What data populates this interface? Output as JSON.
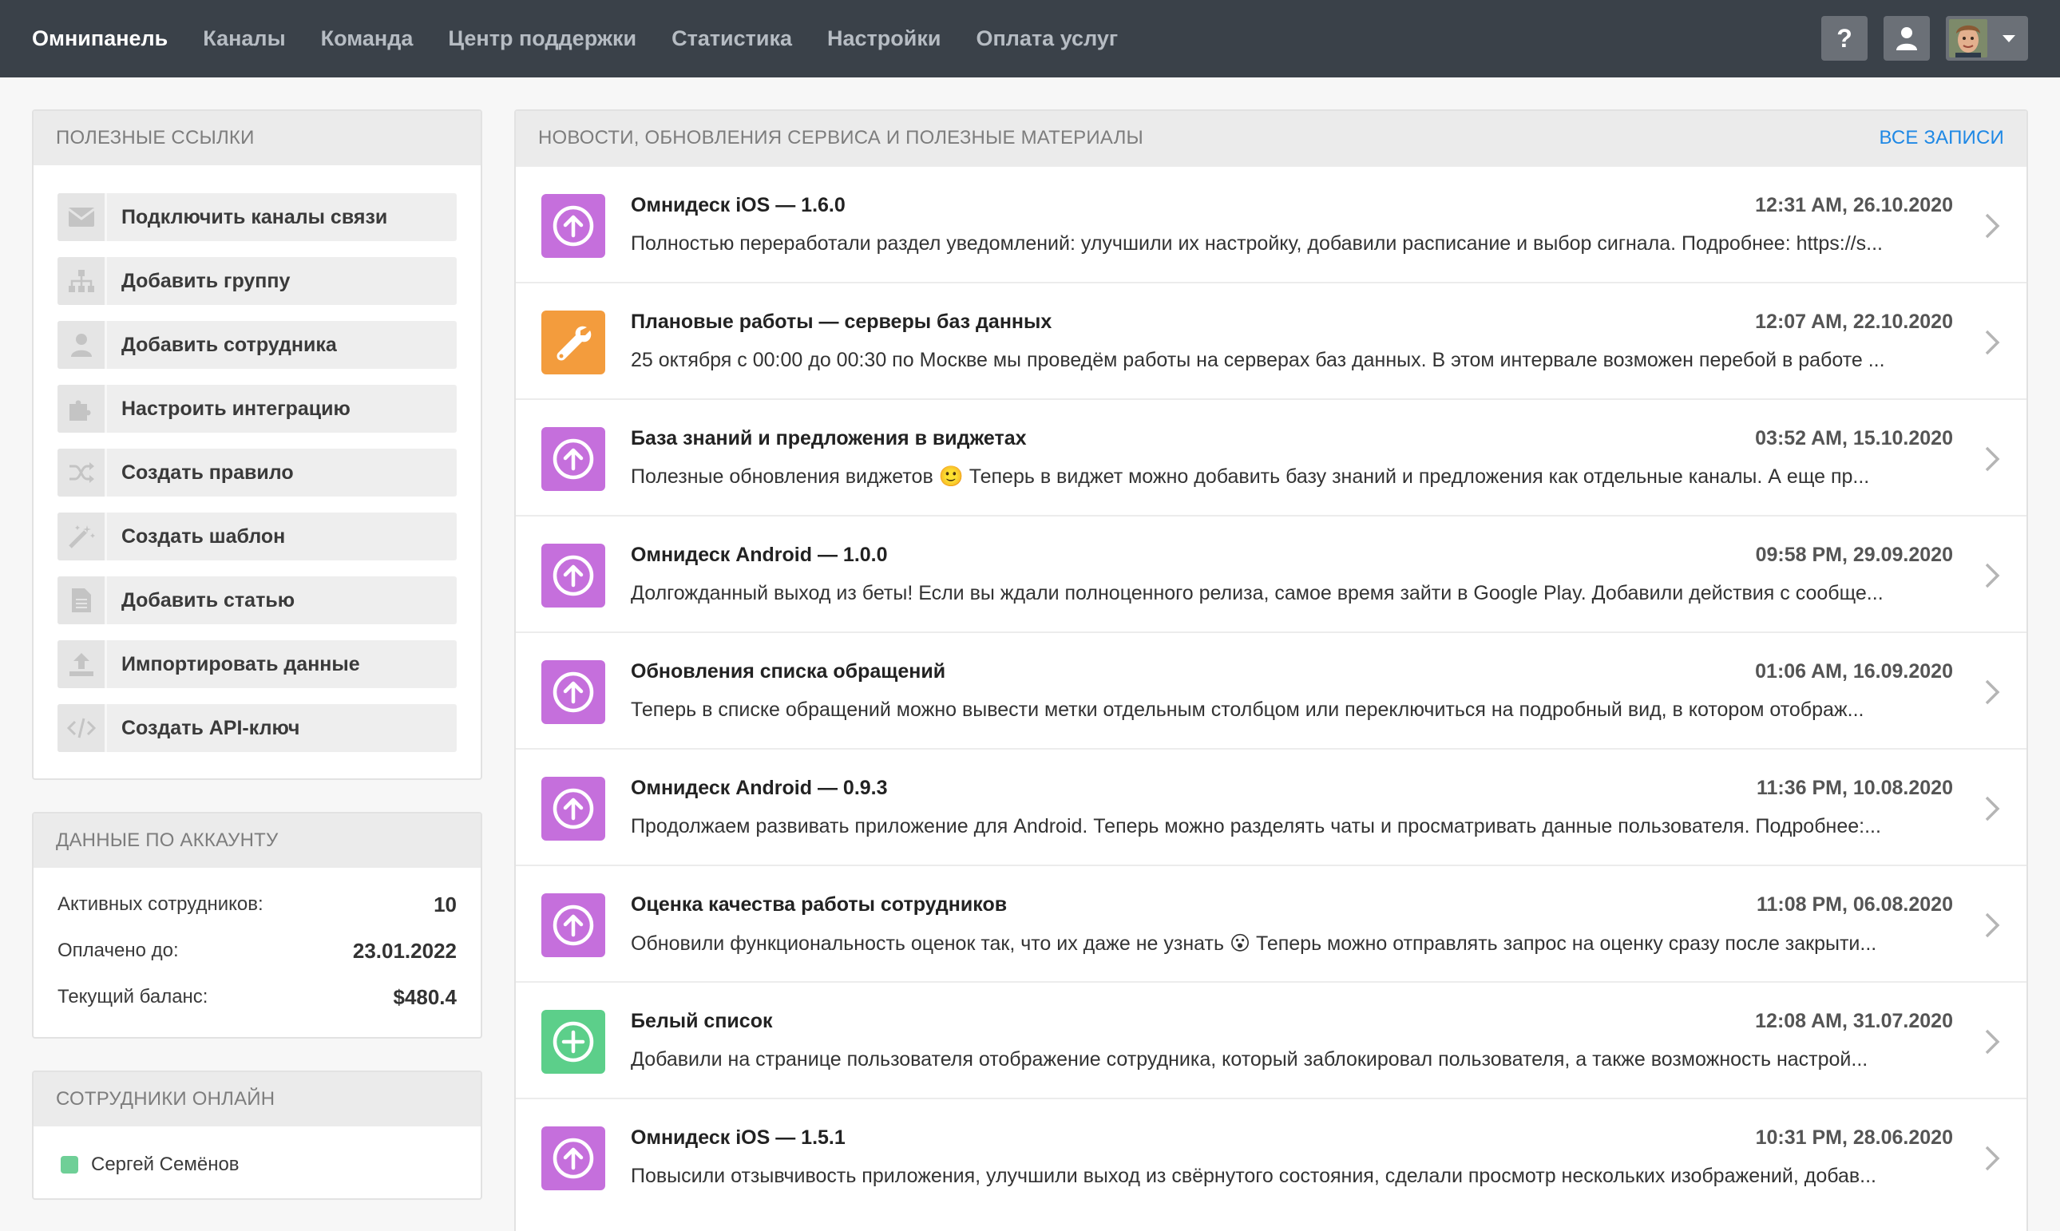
{
  "colors": {
    "topbar": "#3a4149",
    "update_icon": "#c56fdc",
    "maintenance_icon": "#f39c3d",
    "feature_icon": "#5ccf8a",
    "link": "#1e88e5",
    "online": "#6fcf97"
  },
  "nav": {
    "items": [
      {
        "label": "Омнипанель",
        "active": true
      },
      {
        "label": "Каналы",
        "active": false
      },
      {
        "label": "Команда",
        "active": false
      },
      {
        "label": "Центр поддержки",
        "active": false
      },
      {
        "label": "Статистика",
        "active": false
      },
      {
        "label": "Настройки",
        "active": false
      },
      {
        "label": "Оплата услуг",
        "active": false
      }
    ],
    "help_label": "?",
    "icons": [
      "question-icon",
      "user-icon",
      "avatar",
      "caret-down-icon"
    ]
  },
  "links": {
    "title": "ПОЛЕЗНЫЕ ССЫЛКИ",
    "items": [
      {
        "label": "Подключить каналы связи",
        "icon": "envelope-icon"
      },
      {
        "label": "Добавить группу",
        "icon": "sitemap-icon"
      },
      {
        "label": "Добавить сотрудника",
        "icon": "user-icon"
      },
      {
        "label": "Настроить интеграцию",
        "icon": "puzzle-icon"
      },
      {
        "label": "Создать правило",
        "icon": "shuffle-icon"
      },
      {
        "label": "Создать шаблон",
        "icon": "magic-wand-icon"
      },
      {
        "label": "Добавить статью",
        "icon": "document-icon"
      },
      {
        "label": "Импортировать данные",
        "icon": "upload-icon"
      },
      {
        "label": "Создать API-ключ",
        "icon": "code-icon"
      }
    ]
  },
  "account": {
    "title": "ДАННЫЕ ПО АККАУНТУ",
    "rows": [
      {
        "label": "Активных сотрудников:",
        "value": "10"
      },
      {
        "label": "Оплачено до:",
        "value": "23.01.2022"
      },
      {
        "label": "Текущий баланс:",
        "value": "$480.4"
      }
    ]
  },
  "online": {
    "title": "СОТРУДНИКИ ОНЛАЙН",
    "users": [
      {
        "name": "Сергей Семёнов"
      }
    ]
  },
  "news": {
    "title": "НОВОСТИ, ОБНОВЛЕНИЯ СЕРВИСА И ПОЛЕЗНЫЕ МАТЕРИАЛЫ",
    "all_label": "ВСЕ ЗАПИСИ",
    "items": [
      {
        "icon": "arrow-up-circle-icon",
        "kind": "update",
        "title": "Омнидеск iOS — 1.6.0",
        "date": "12:31 AM, 26.10.2020",
        "text": "Полностью переработали раздел уведомлений: улучшили их настройку, добавили расписание и выбор сигнала. Подробнее: https://s..."
      },
      {
        "icon": "wrench-icon",
        "kind": "maintenance",
        "title": "Плановые работы — серверы баз данных",
        "date": "12:07 AM, 22.10.2020",
        "text": "25 октября с 00:00 до 00:30 по Москве мы проведём работы на серверах баз данных. В этом интервале возможен перебой в работе ..."
      },
      {
        "icon": "arrow-up-circle-icon",
        "kind": "update",
        "title": "База знаний и предложения в виджетах",
        "date": "03:52 AM, 15.10.2020",
        "text": "Полезные обновления виджетов 🙂 Теперь в виджет можно добавить базу знаний и предложения как отдельные каналы. А еще пр..."
      },
      {
        "icon": "arrow-up-circle-icon",
        "kind": "update",
        "title": "Омнидеск Android — 1.0.0",
        "date": "09:58 PM, 29.09.2020",
        "text": "Долгожданный выход из беты! Если вы ждали полноценного релиза, самое время зайти в Google Play. Добавили действия с сообще..."
      },
      {
        "icon": "arrow-up-circle-icon",
        "kind": "update",
        "title": "Обновления списка обращений",
        "date": "01:06 AM, 16.09.2020",
        "text": "Теперь в списке обращений можно вывести метки отдельным столбцом или переключиться на подробный вид, в котором отображ..."
      },
      {
        "icon": "arrow-up-circle-icon",
        "kind": "update",
        "title": "Омнидеск Android — 0.9.3",
        "date": "11:36 PM, 10.08.2020",
        "text": "Продолжаем развивать приложение для Android. Теперь можно разделять чаты и просматривать данные пользователя. Подробнее:..."
      },
      {
        "icon": "arrow-up-circle-icon",
        "kind": "update",
        "title": "Оценка качества работы сотрудников",
        "date": "11:08 PM, 06.08.2020",
        "text": "Обновили функциональность оценок так, что их даже не узнать 😮 Теперь можно отправлять запрос на оценку сразу после закрыти..."
      },
      {
        "icon": "plus-circle-icon",
        "kind": "feature",
        "title": "Белый список",
        "date": "12:08 AM, 31.07.2020",
        "text": "Добавили на странице пользователя отображение сотрудника, который заблокировал пользователя, а также возможность настрой..."
      },
      {
        "icon": "arrow-up-circle-icon",
        "kind": "update",
        "title": "Омнидеск iOS — 1.5.1",
        "date": "10:31 PM, 28.06.2020",
        "text": "Повысили отзывчивость приложения, улучшили выход из свёрнутого состояния, сделали просмотр нескольких изображений, добав..."
      }
    ]
  }
}
